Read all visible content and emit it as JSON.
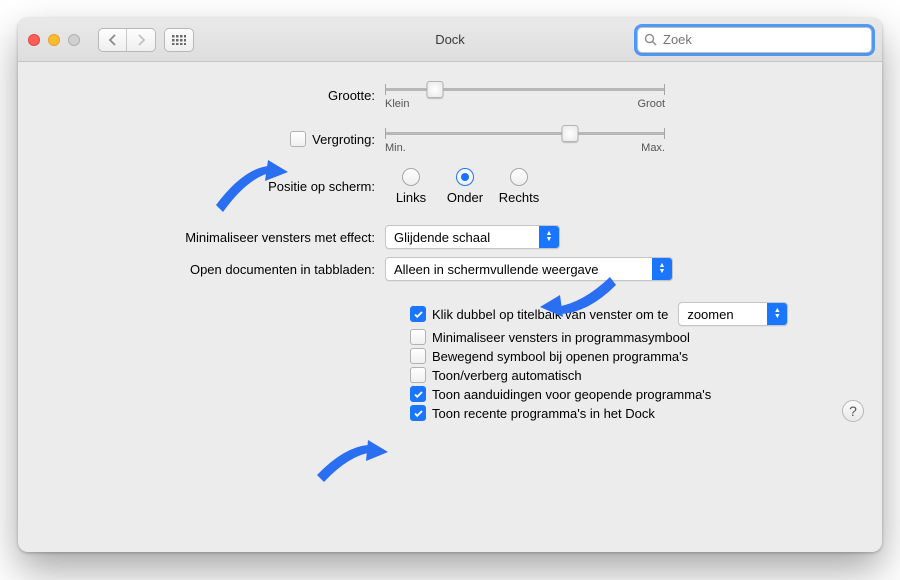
{
  "window": {
    "title": "Dock"
  },
  "search": {
    "placeholder": "Zoek"
  },
  "rows": {
    "size": {
      "label": "Grootte:",
      "minLabel": "Klein",
      "maxLabel": "Groot",
      "knobPct": 18
    },
    "magnification": {
      "label": "Vergroting:",
      "minLabel": "Min.",
      "maxLabel": "Max.",
      "checked": false,
      "knobPct": 66
    },
    "position": {
      "label": "Positie op scherm:",
      "options": {
        "left": "Links",
        "bottom": "Onder",
        "right": "Rechts"
      },
      "selected": "bottom"
    },
    "minimizeEffect": {
      "label": "Minimaliseer vensters met effect:",
      "value": "Glijdende schaal"
    },
    "openTabs": {
      "label": "Open documenten in tabbladen:",
      "value": "Alleen in schermvullende weergave"
    }
  },
  "checkboxes": {
    "doubleClick": {
      "checked": true,
      "label": "Klik dubbel op titelbalk van venster om te",
      "popupValue": "zoomen"
    },
    "minimizeIntoIcon": {
      "checked": false,
      "label": "Minimaliseer vensters in programmasymbool"
    },
    "animateOpen": {
      "checked": false,
      "label": "Bewegend symbool bij openen programma's"
    },
    "autoHide": {
      "checked": false,
      "label": "Toon/verberg automatisch"
    },
    "indicators": {
      "checked": true,
      "label": "Toon aanduidingen voor geopende programma's"
    },
    "recent": {
      "checked": true,
      "label": "Toon recente programma's in het Dock"
    }
  },
  "help": "?"
}
